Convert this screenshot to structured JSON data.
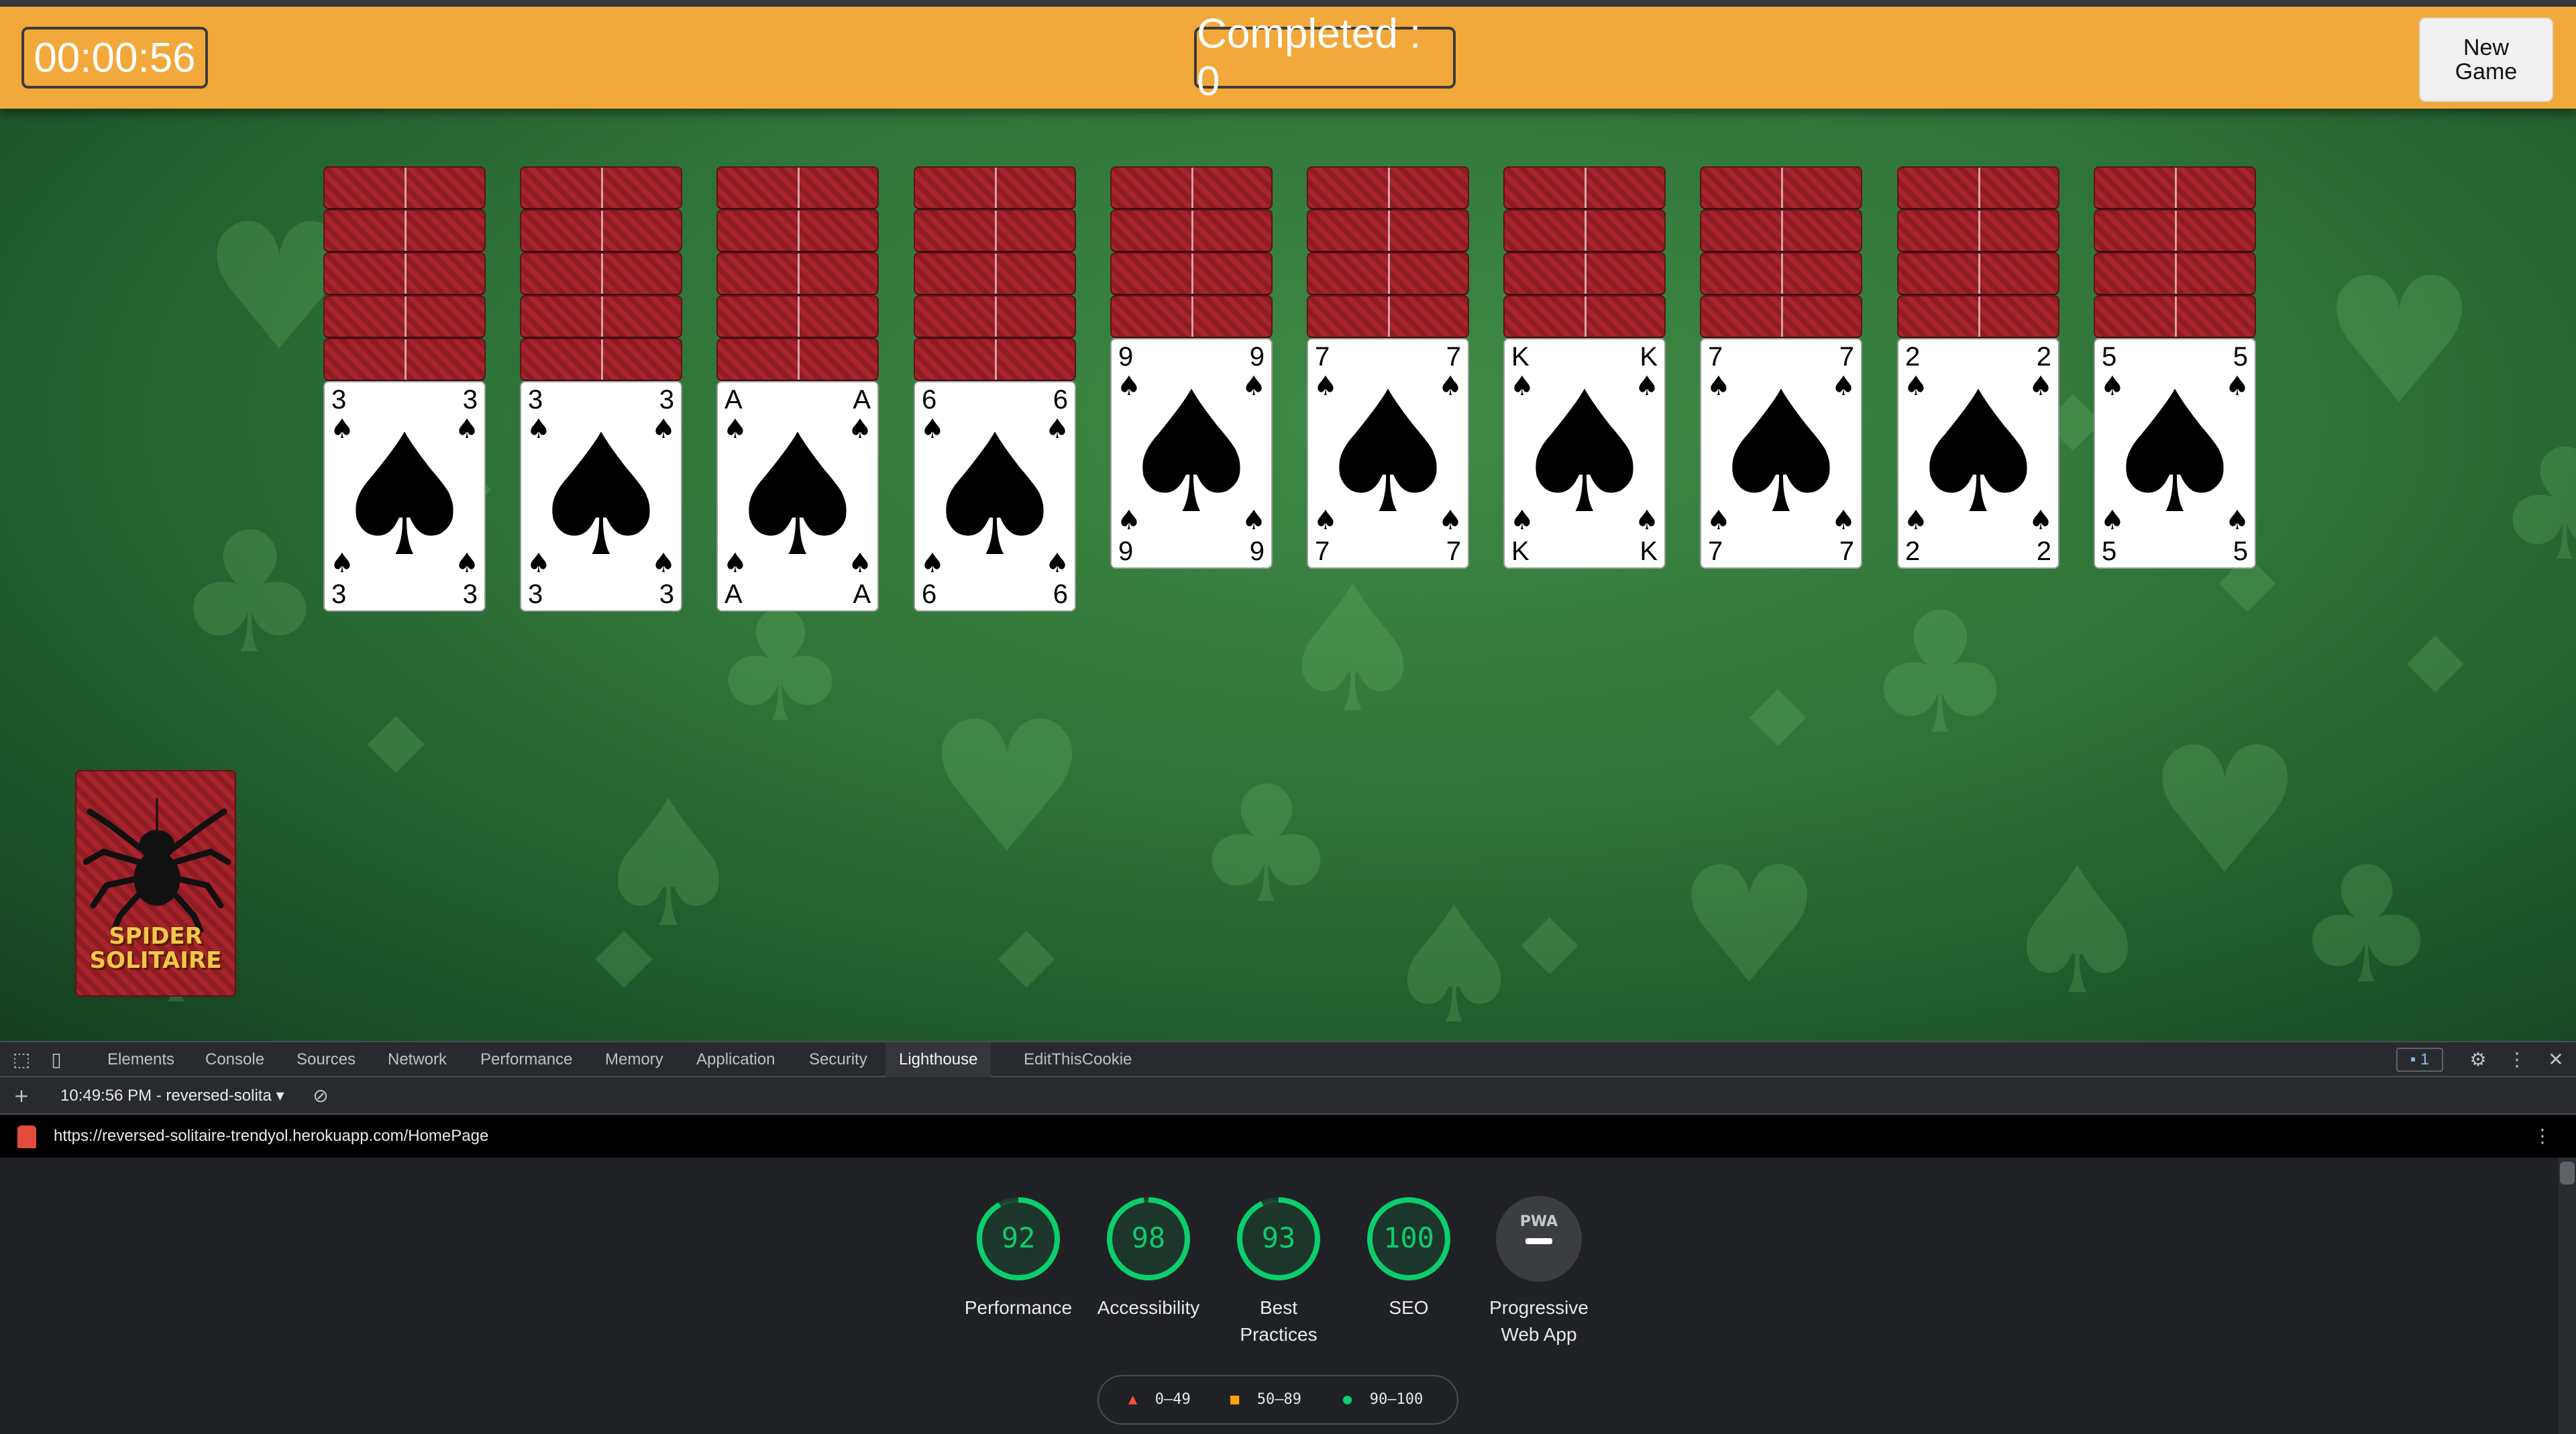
{
  "topbar": {
    "timer": "00:00:56",
    "completed": "Completed : 0",
    "new_game_line1": "New",
    "new_game_line2": "Game"
  },
  "columns": [
    {
      "hidden": 5,
      "rank": "3",
      "suit": "♠"
    },
    {
      "hidden": 5,
      "rank": "3",
      "suit": "♠"
    },
    {
      "hidden": 5,
      "rank": "A",
      "suit": "♠"
    },
    {
      "hidden": 5,
      "rank": "6",
      "suit": "♠"
    },
    {
      "hidden": 4,
      "rank": "9",
      "suit": "♠"
    },
    {
      "hidden": 4,
      "rank": "7",
      "suit": "♠"
    },
    {
      "hidden": 4,
      "rank": "K",
      "suit": "♠"
    },
    {
      "hidden": 4,
      "rank": "7",
      "suit": "♠"
    },
    {
      "hidden": 4,
      "rank": "2",
      "suit": "♠"
    },
    {
      "hidden": 4,
      "rank": "5",
      "suit": "♠"
    }
  ],
  "stock": {
    "line1": "SPIDER",
    "line2": "SOLITAIRE"
  },
  "devtools": {
    "tabs": [
      "Elements",
      "Console",
      "Sources",
      "Network",
      "Performance",
      "Memory",
      "Application",
      "Security",
      "Lighthouse",
      "EditThisCookie"
    ],
    "active_tab": "Lighthouse",
    "message_count": "1",
    "report_label": "10:49:56 PM - reversed-solita",
    "url": "https://reversed-solitaire-trendyol.herokuapp.com/HomePage",
    "scores": [
      {
        "score": "92",
        "label": "Performance",
        "value": 92
      },
      {
        "score": "98",
        "label": "Accessibility",
        "value": 98
      },
      {
        "score": "93",
        "label": "Best Practices",
        "value": 93
      },
      {
        "score": "100",
        "label": "SEO",
        "value": 100
      }
    ],
    "pwa": {
      "badge": "PWA",
      "label": "Progressive Web App"
    },
    "legend": [
      "0–49",
      "50–89",
      "90–100"
    ],
    "colors": {
      "pass": "#0cce6b",
      "average": "#ffa400",
      "fail": "#ff4e42",
      "pwa_bg": "#3c3d40"
    }
  }
}
